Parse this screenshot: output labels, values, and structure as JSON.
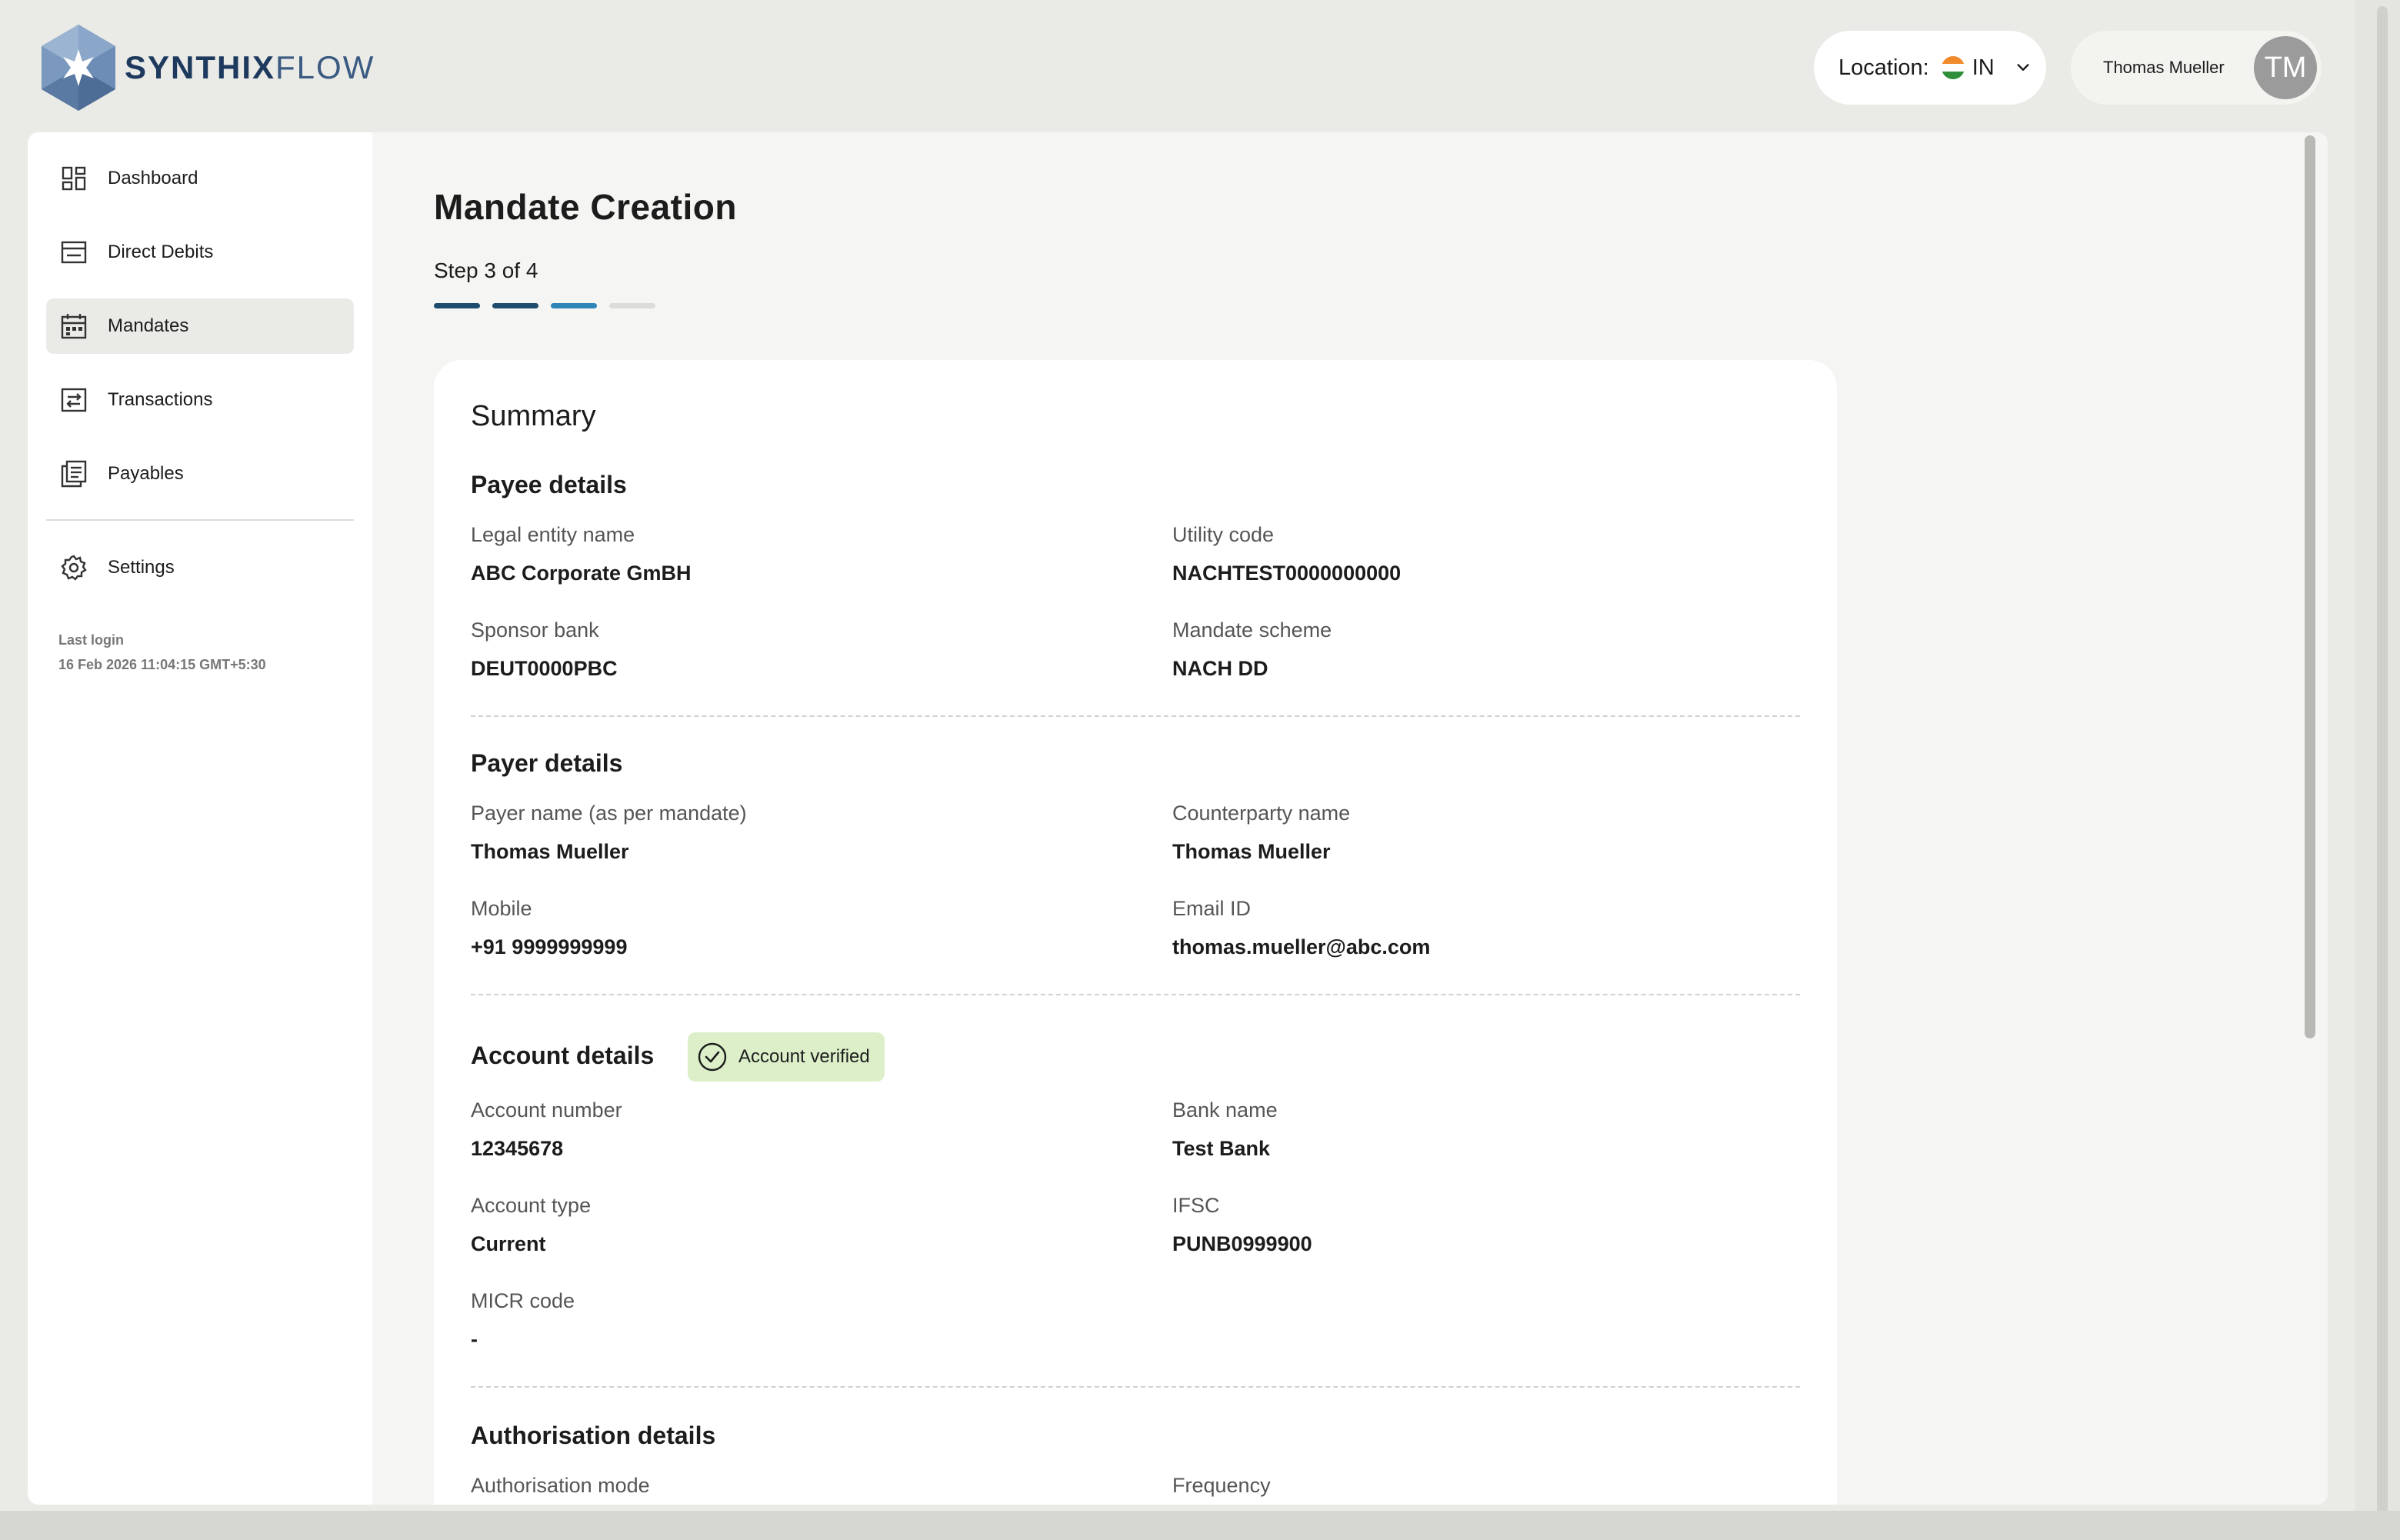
{
  "brand": {
    "name_bold": "SYNTHIX",
    "name_light": "FLOW"
  },
  "header": {
    "location_label": "Location:",
    "location_value": "IN",
    "user_name": "Thomas Mueller",
    "user_initials": "TM"
  },
  "sidebar": {
    "items": [
      {
        "label": "Dashboard",
        "icon": "dashboard-icon"
      },
      {
        "label": "Direct Debits",
        "icon": "direct-debits-icon"
      },
      {
        "label": "Mandates",
        "icon": "calendar-icon",
        "active": true
      },
      {
        "label": "Transactions",
        "icon": "transactions-icon"
      },
      {
        "label": "Payables",
        "icon": "payables-icon"
      }
    ],
    "settings_label": "Settings",
    "last_login_label": "Last login",
    "last_login_value": "16 Feb 2026 11:04:15 GMT+5:30"
  },
  "page": {
    "title": "Mandate Creation",
    "step_text": "Step 3 of 4",
    "step_colors": [
      "#1d4c6e",
      "#1d4c6e",
      "#2e86b8",
      "#dcdcd8"
    ]
  },
  "summary": {
    "title": "Summary",
    "payee": {
      "title": "Payee details",
      "legal_entity_label": "Legal entity name",
      "legal_entity_value": "ABC Corporate GmBH",
      "utility_code_label": "Utility code",
      "utility_code_value": "NACHTEST0000000000",
      "sponsor_bank_label": "Sponsor bank",
      "sponsor_bank_value": "DEUT0000PBC",
      "mandate_scheme_label": "Mandate scheme",
      "mandate_scheme_value": "NACH DD"
    },
    "payer": {
      "title": "Payer details",
      "payer_name_label": "Payer name (as per mandate)",
      "payer_name_value": "Thomas Mueller",
      "counterparty_label": "Counterparty name",
      "counterparty_value": "Thomas Mueller",
      "mobile_label": "Mobile",
      "mobile_value": "+91 9999999999",
      "email_label": "Email ID",
      "email_value": "thomas.mueller@abc.com"
    },
    "account": {
      "title": "Account details",
      "badge": "Account verified",
      "account_number_label": "Account number",
      "account_number_value": "12345678",
      "bank_name_label": "Bank name",
      "bank_name_value": "Test Bank",
      "account_type_label": "Account type",
      "account_type_value": "Current",
      "ifsc_label": "IFSC",
      "ifsc_value": "PUNB0999900",
      "micr_label": "MICR code",
      "micr_value": "-"
    },
    "authorisation": {
      "title": "Authorisation details",
      "mode_label": "Authorisation mode",
      "frequency_label": "Frequency"
    }
  }
}
